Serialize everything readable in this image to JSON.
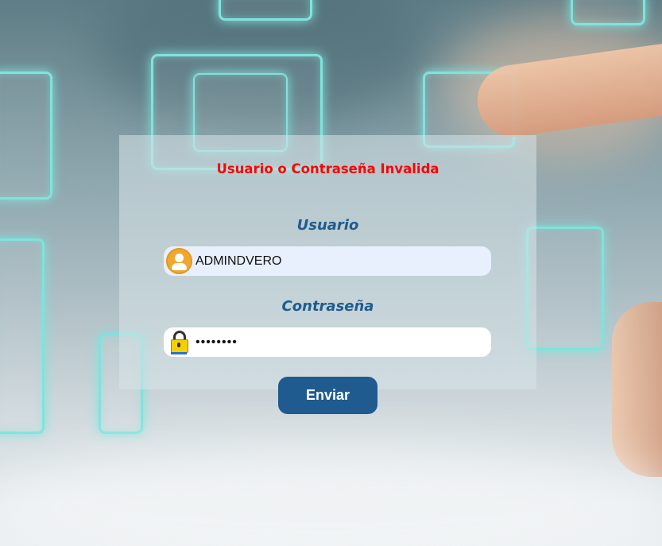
{
  "login": {
    "error_message": "Usuario o Contraseña Invalida",
    "username_label": "Usuario",
    "username_value": "ADMINDVERO",
    "password_label": "Contraseña",
    "password_value": "••••••••",
    "submit_label": "Enviar"
  },
  "icons": {
    "user": "user-avatar-icon",
    "password": "padlock-icon"
  },
  "colors": {
    "error": "#ff0000",
    "label": "#1f5b8e",
    "button": "#1f5b8e",
    "username_field_bg": "#e8f0fe"
  }
}
